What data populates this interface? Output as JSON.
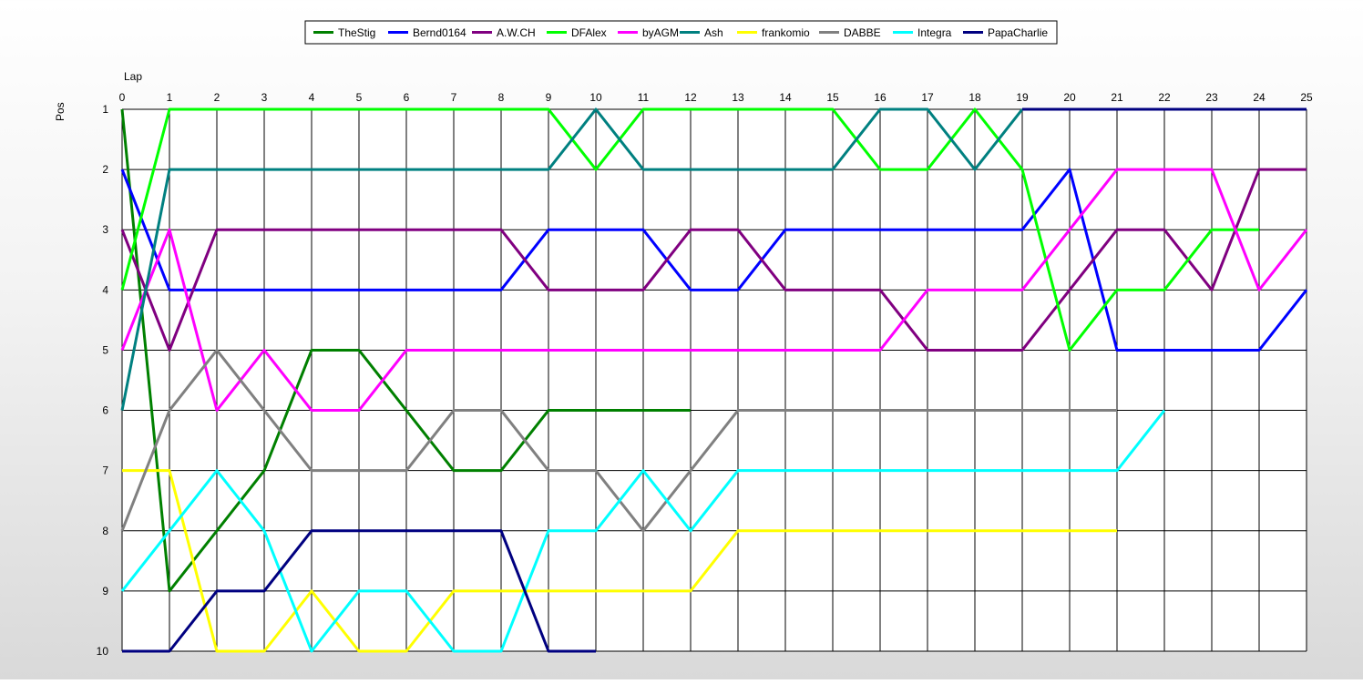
{
  "chart_data": {
    "type": "line",
    "xlabel": "Lap",
    "ylabel": "Pos",
    "xlim": [
      0,
      25
    ],
    "ylim": [
      1,
      10
    ],
    "y_inverted": true,
    "grid": true,
    "legend_position": "top-center",
    "x_ticks": [
      0,
      1,
      2,
      3,
      4,
      5,
      6,
      7,
      8,
      9,
      10,
      11,
      12,
      13,
      14,
      15,
      16,
      17,
      18,
      19,
      20,
      21,
      22,
      23,
      24,
      25
    ],
    "y_ticks": [
      1,
      2,
      3,
      4,
      5,
      6,
      7,
      8,
      9,
      10
    ],
    "series": [
      {
        "name": "TheStig",
        "color": "#008000",
        "x": [
          0,
          1,
          2,
          3,
          4,
          5,
          6,
          7,
          8,
          9,
          10,
          11,
          12
        ],
        "y": [
          1,
          9,
          8,
          7,
          5,
          5,
          6,
          7,
          7,
          6,
          6,
          6,
          6
        ]
      },
      {
        "name": "Bernd0164",
        "color": "#0000ff",
        "x": [
          0,
          1,
          2,
          3,
          4,
          5,
          6,
          7,
          8,
          9,
          10,
          11,
          12,
          13,
          14,
          15,
          16,
          17,
          18,
          19,
          20,
          21,
          22,
          23,
          24,
          25
        ],
        "y": [
          2,
          4,
          4,
          4,
          4,
          4,
          4,
          4,
          4,
          3,
          3,
          3,
          4,
          4,
          3,
          3,
          3,
          3,
          3,
          3,
          2,
          5,
          5,
          5,
          5,
          4
        ]
      },
      {
        "name": "A.W.CH",
        "color": "#800080",
        "x": [
          0,
          1,
          2,
          3,
          4,
          5,
          6,
          7,
          8,
          9,
          10,
          11,
          12,
          13,
          14,
          15,
          16,
          17,
          18,
          19,
          20,
          21,
          22,
          23,
          24,
          25
        ],
        "y": [
          3,
          5,
          3,
          3,
          3,
          3,
          3,
          3,
          3,
          4,
          4,
          4,
          3,
          3,
          4,
          4,
          4,
          5,
          5,
          5,
          4,
          3,
          3,
          4,
          2,
          2
        ]
      },
      {
        "name": "DFAlex",
        "color": "#00ff00",
        "x": [
          0,
          1,
          2,
          3,
          4,
          5,
          6,
          7,
          8,
          9,
          10,
          11,
          12,
          13,
          14,
          15,
          16,
          17,
          18,
          19,
          20,
          21,
          22,
          23,
          24
        ],
        "y": [
          4,
          1,
          1,
          1,
          1,
          1,
          1,
          1,
          1,
          1,
          2,
          1,
          1,
          1,
          1,
          1,
          2,
          2,
          1,
          2,
          5,
          4,
          4,
          3,
          3
        ]
      },
      {
        "name": "byAGM",
        "color": "#ff00ff",
        "x": [
          0,
          1,
          2,
          3,
          4,
          5,
          6,
          7,
          8,
          9,
          10,
          11,
          12,
          13,
          14,
          15,
          16,
          17,
          18,
          19,
          20,
          21,
          22,
          23,
          24,
          25
        ],
        "y": [
          5,
          3,
          6,
          5,
          6,
          6,
          5,
          5,
          5,
          5,
          5,
          5,
          5,
          5,
          5,
          5,
          5,
          4,
          4,
          4,
          3,
          2,
          2,
          2,
          4,
          3
        ]
      },
      {
        "name": "Ash",
        "color": "#008080",
        "x": [
          0,
          1,
          2,
          3,
          4,
          5,
          6,
          7,
          8,
          9,
          10,
          11,
          12,
          13,
          14,
          15,
          16,
          17,
          18,
          19
        ],
        "y": [
          6,
          2,
          2,
          2,
          2,
          2,
          2,
          2,
          2,
          2,
          1,
          2,
          2,
          2,
          2,
          2,
          1,
          1,
          2,
          1
        ]
      },
      {
        "name": "frankomio",
        "color": "#ffff00",
        "x": [
          0,
          1,
          2,
          3,
          4,
          5,
          6,
          7,
          8,
          9,
          10,
          11,
          12,
          13,
          14,
          15,
          16,
          17,
          18,
          19,
          20,
          21
        ],
        "y": [
          7,
          7,
          10,
          10,
          9,
          10,
          10,
          9,
          9,
          9,
          9,
          9,
          9,
          8,
          8,
          8,
          8,
          8,
          8,
          8,
          8,
          8
        ]
      },
      {
        "name": "DABBE",
        "color": "#808080",
        "x": [
          0,
          1,
          2,
          3,
          4,
          5,
          6,
          7,
          8,
          9,
          10,
          11,
          12,
          13,
          14,
          15,
          16,
          17,
          18,
          19,
          20,
          21
        ],
        "y": [
          8,
          6,
          5,
          6,
          7,
          7,
          7,
          6,
          6,
          7,
          7,
          8,
          7,
          6,
          6,
          6,
          6,
          6,
          6,
          6,
          6,
          6
        ]
      },
      {
        "name": "Integra",
        "color": "#00ffff",
        "x": [
          0,
          1,
          2,
          3,
          4,
          5,
          6,
          7,
          8,
          9,
          10,
          11,
          12,
          13,
          14,
          15,
          16,
          17,
          18,
          19,
          20,
          21,
          22
        ],
        "y": [
          9,
          8,
          7,
          8,
          10,
          9,
          9,
          10,
          10,
          8,
          8,
          7,
          8,
          7,
          7,
          7,
          7,
          7,
          7,
          7,
          7,
          7,
          6
        ]
      },
      {
        "name": "PapaCharlie",
        "color": "#000080",
        "x": [
          0,
          1,
          2,
          3,
          4,
          5,
          6,
          7,
          8,
          9,
          10,
          19,
          20,
          21,
          22,
          23,
          24,
          25
        ],
        "y": [
          10,
          10,
          9,
          9,
          8,
          8,
          8,
          8,
          8,
          10,
          10,
          1,
          1,
          1,
          1,
          1,
          1,
          1
        ],
        "segments": [
          [
            0,
            10
          ],
          [
            11,
            17
          ]
        ]
      }
    ]
  }
}
